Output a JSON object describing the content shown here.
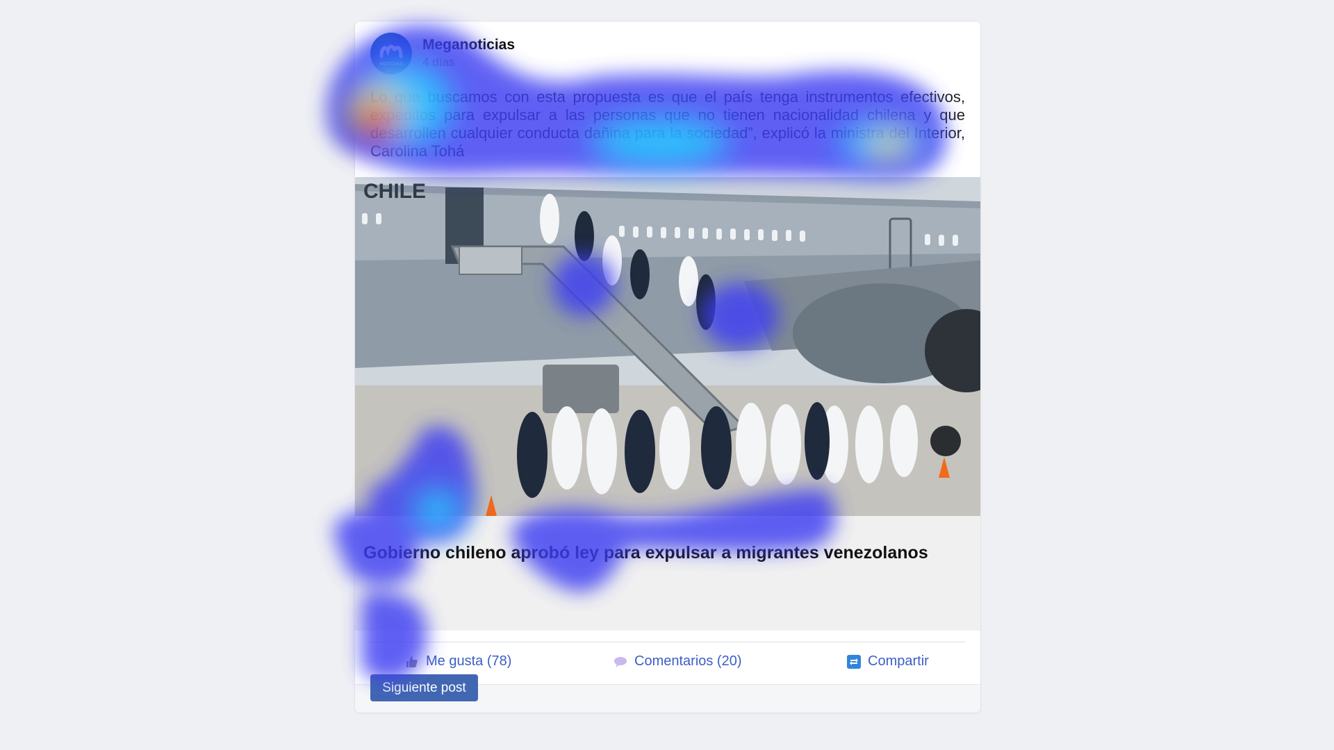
{
  "post": {
    "page_name": "Meganoticias",
    "avatar_text": "NOTICIAS",
    "time": "4 días",
    "text": "Lo que buscamos con esta propuesta es que el país tenga instrumentos efectivos, expeditos para expulsar a las personas que no tienen nacionalidad chilena y que desarrollen cualquier conducta dañina para la sociedad”, explicó la ministra del Interior, Carolina Tohá",
    "photo_text": "CHILE",
    "photo_alt": "Migrants in white protective suits boarding a Chilean Air Force plane escorted by PDI officers",
    "headline": "Gobierno chileno aprobó ley para expulsar a migrantes venezolanos"
  },
  "actions": {
    "like_label": "Me gusta (78)",
    "comment_label": "Comentarios (20)",
    "share_label": "Compartir",
    "like_icon": "thumbs-up-icon",
    "comment_icon": "speech-bubble-icon",
    "share_icon": "share-icon"
  },
  "next_button_label": "Siguiente post",
  "colors": {
    "accent": "#4267b2",
    "link": "#3b5ec6",
    "background": "#eff0f3"
  }
}
